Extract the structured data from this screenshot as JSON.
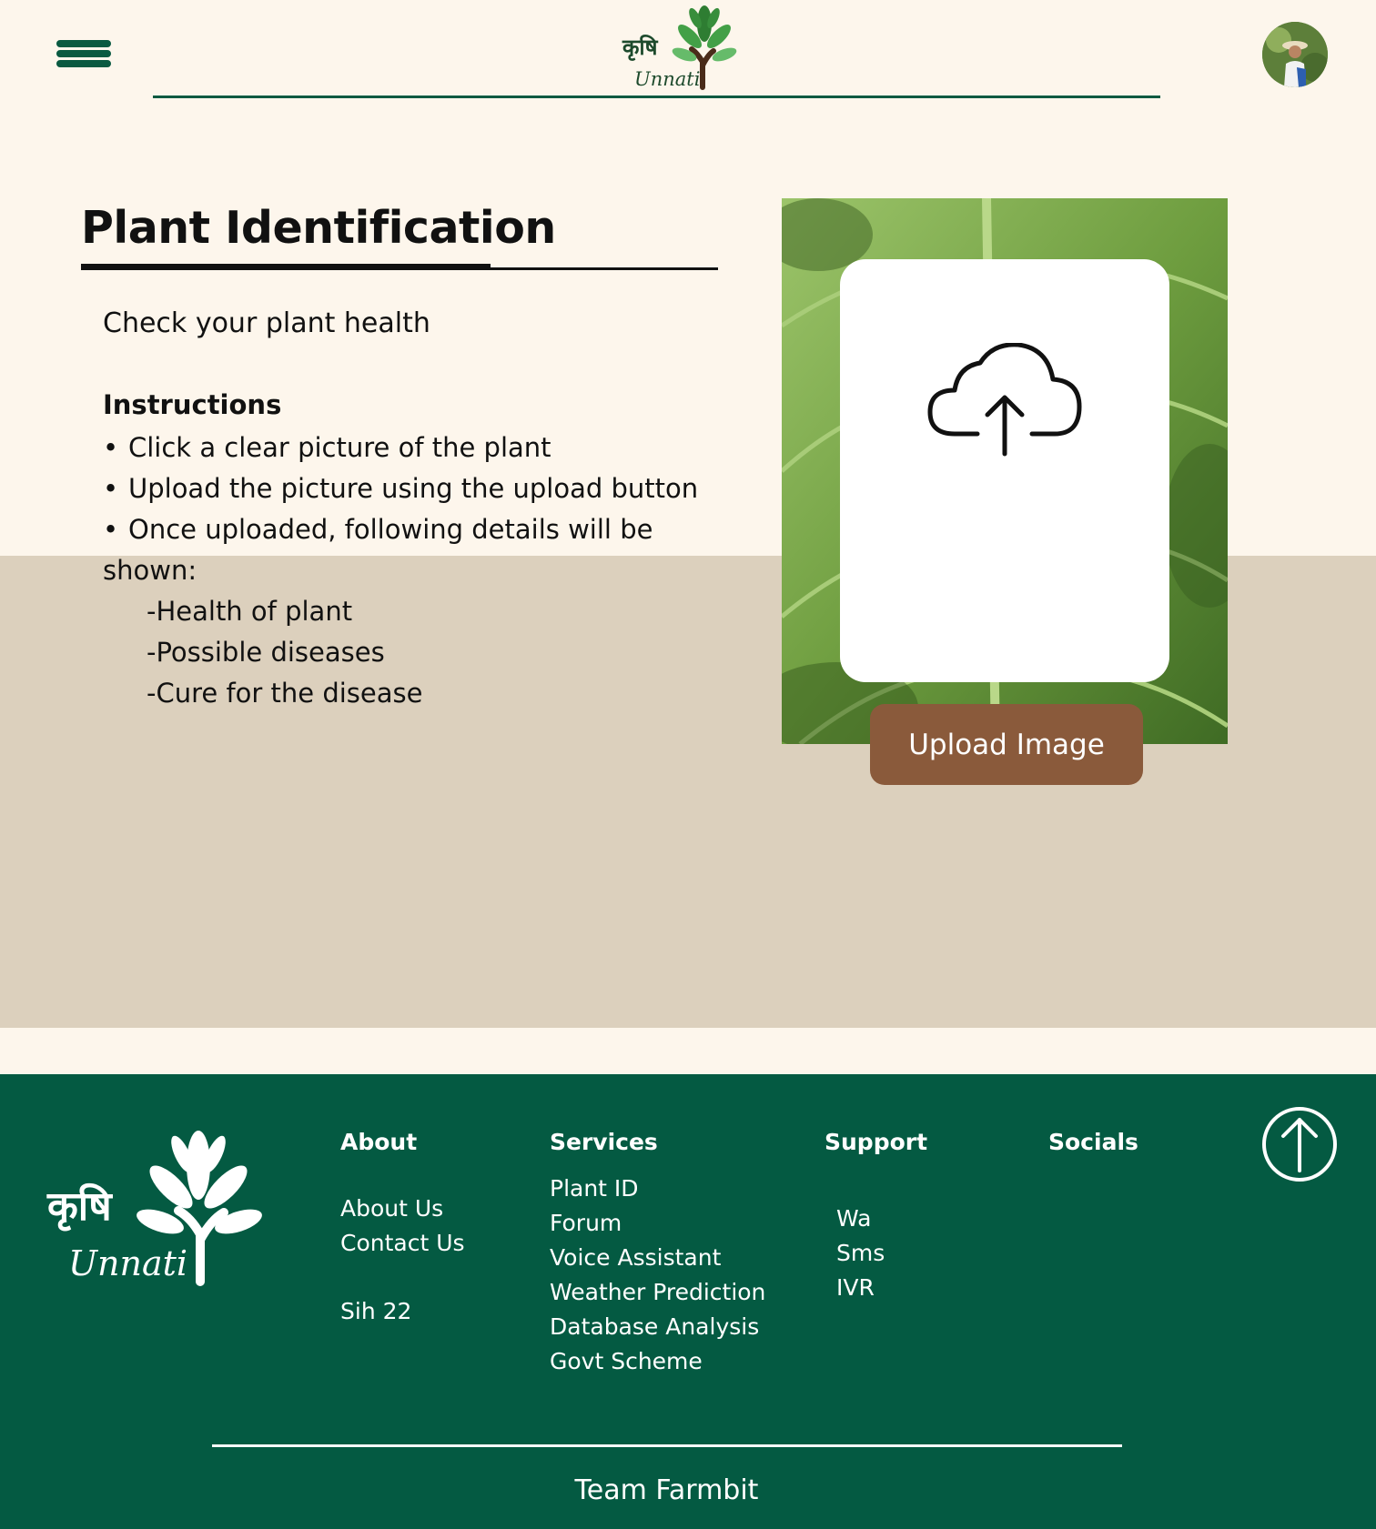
{
  "header": {
    "logo_text_hindi": "कृषि",
    "logo_text": "Unnati"
  },
  "main": {
    "title": "Plant Identification",
    "subtitle": "Check your plant health",
    "instructions_heading": "Instructions",
    "instructions": [
      "Click a clear picture of the plant",
      "Upload the picture using the upload button",
      "Once uploaded, following details will  be"
    ],
    "instructions_continued": "shown:",
    "details": [
      "-Health of plant",
      "-Possible diseases",
      "-Cure for the disease"
    ],
    "upload_button": "Upload Image"
  },
  "footer": {
    "logo_text_hindi": "कृषि",
    "logo_text": "Unnati",
    "about": {
      "heading": "About",
      "links": [
        "About Us",
        "Contact Us"
      ],
      "extra": "Sih 22"
    },
    "services": {
      "heading": "Services",
      "links": [
        "Plant ID",
        "Forum",
        "Voice Assistant",
        "Weather Prediction",
        "Database Analysis",
        "Govt Scheme"
      ]
    },
    "support": {
      "heading": "Support",
      "links": [
        "Wa",
        "Sms",
        "IVR"
      ]
    },
    "socials": {
      "heading": "Socials"
    },
    "team": "Team Farmbit"
  },
  "colors": {
    "page_bg": "#fdf6ec",
    "band_bg": "#dcd0bd",
    "brand_green": "#045a42",
    "button_brown": "#8a5a3b"
  },
  "icons": [
    "menu-icon",
    "user-avatar",
    "cloud-upload-icon",
    "arrow-up-icon"
  ]
}
